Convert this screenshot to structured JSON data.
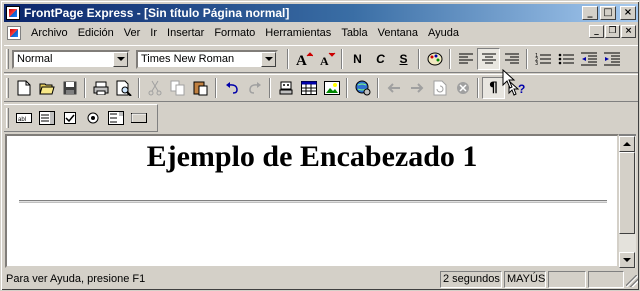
{
  "window": {
    "title": "FrontPage Express - [Sin título Página normal]"
  },
  "menu": {
    "items": [
      "Archivo",
      "Edición",
      "Ver",
      "Ir",
      "Insertar",
      "Formato",
      "Herramientas",
      "Tabla",
      "Ventana",
      "Ayuda"
    ]
  },
  "format_toolbar": {
    "style_value": "Normal",
    "font_value": "Times New Roman",
    "bold_label": "N",
    "italic_label": "C",
    "underline_label": "S",
    "pilcrow_label": "¶"
  },
  "document": {
    "heading": "Ejemplo de Encabezado 1"
  },
  "statusbar": {
    "message": "Para ver Ayuda, presione F1",
    "time": "2 segundos",
    "caps": "MAYÚS"
  },
  "colors": {
    "title_gradient_start": "#0a246a",
    "title_gradient_end": "#a6caf0",
    "chrome": "#d4d0c8"
  }
}
